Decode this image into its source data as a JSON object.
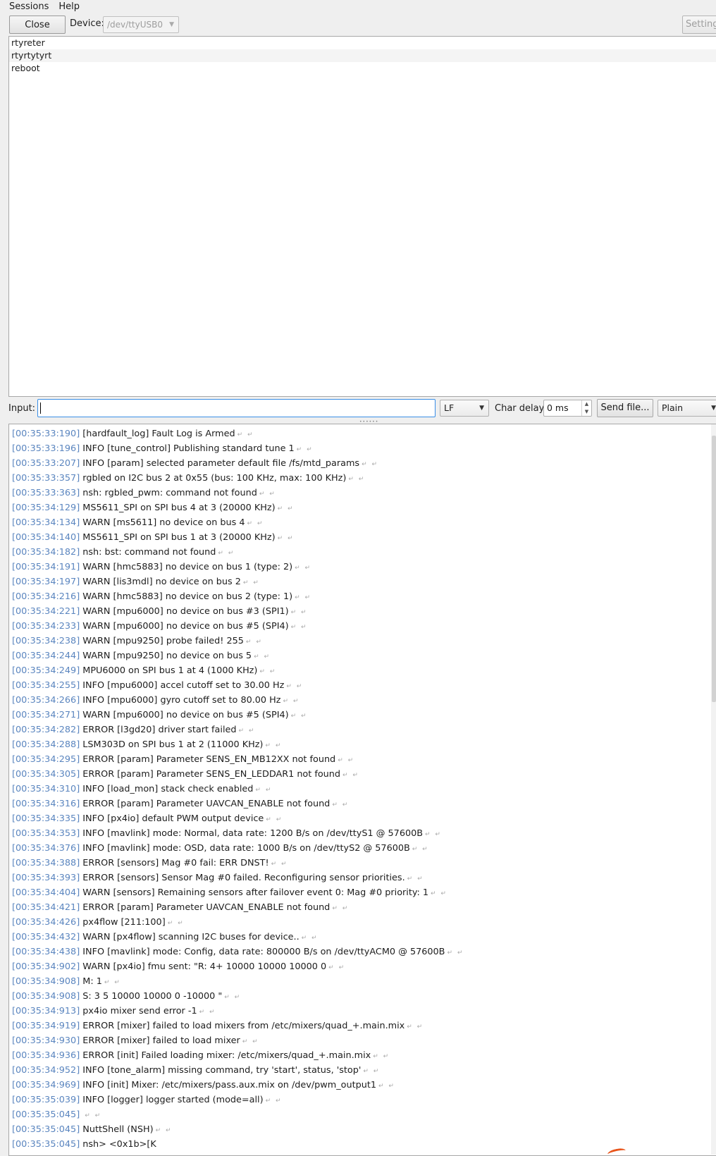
{
  "menubar": {
    "items": [
      {
        "label": "Sessions"
      },
      {
        "label": "Help"
      }
    ]
  },
  "toolbar": {
    "close_label": "Close",
    "device_label": "Device:",
    "device_value": "/dev/ttyUSB0",
    "settings_label": "Settings"
  },
  "history": {
    "items": [
      "rtyreter",
      "rtyrtytyrt",
      "reboot"
    ]
  },
  "input_row": {
    "input_label": "Input:",
    "input_value": "",
    "line_ending": "LF",
    "char_delay_label": "Char delay:",
    "char_delay_value": "0 ms",
    "send_file_label": "Send file...",
    "format": "Plain"
  },
  "log": {
    "lines": [
      {
        "ts": "[00:35:33:190]",
        "msg": "[hardfault_log] Fault Log is Armed"
      },
      {
        "ts": "[00:35:33:196]",
        "msg": "INFO  [tune_control] Publishing standard tune 1"
      },
      {
        "ts": "[00:35:33:207]",
        "msg": "INFO  [param] selected parameter default file /fs/mtd_params"
      },
      {
        "ts": "[00:35:33:357]",
        "msg": "rgbled on I2C bus 2 at 0x55 (bus: 100 KHz, max: 100 KHz)"
      },
      {
        "ts": "[00:35:33:363]",
        "msg": "nsh: rgbled_pwm: command not found"
      },
      {
        "ts": "[00:35:34:129]",
        "msg": "MS5611_SPI on SPI bus 4 at 3 (20000 KHz)"
      },
      {
        "ts": "[00:35:34:134]",
        "msg": "WARN  [ms5611] no device on bus 4"
      },
      {
        "ts": "[00:35:34:140]",
        "msg": "MS5611_SPI on SPI bus 1 at 3 (20000 KHz)"
      },
      {
        "ts": "[00:35:34:182]",
        "msg": "nsh: bst: command not found"
      },
      {
        "ts": "[00:35:34:191]",
        "msg": "WARN  [hmc5883] no device on bus 1 (type: 2)"
      },
      {
        "ts": "[00:35:34:197]",
        "msg": "WARN  [lis3mdl] no device on bus 2"
      },
      {
        "ts": "[00:35:34:216]",
        "msg": "WARN  [hmc5883] no device on bus 2 (type: 1)"
      },
      {
        "ts": "[00:35:34:221]",
        "msg": "WARN  [mpu6000] no device on bus #3 (SPI1)"
      },
      {
        "ts": "[00:35:34:233]",
        "msg": "WARN  [mpu6000] no device on bus #5 (SPI4)"
      },
      {
        "ts": "[00:35:34:238]",
        "msg": "WARN  [mpu9250] probe failed! 255"
      },
      {
        "ts": "[00:35:34:244]",
        "msg": "WARN  [mpu9250] no device on bus 5"
      },
      {
        "ts": "[00:35:34:249]",
        "msg": "MPU6000 on SPI bus 1 at 4 (1000 KHz)"
      },
      {
        "ts": "[00:35:34:255]",
        "msg": "INFO  [mpu6000] accel cutoff set to 30.00 Hz"
      },
      {
        "ts": "[00:35:34:266]",
        "msg": "INFO  [mpu6000] gyro cutoff set to 80.00 Hz"
      },
      {
        "ts": "[00:35:34:271]",
        "msg": "WARN  [mpu6000] no device on bus #5 (SPI4)"
      },
      {
        "ts": "[00:35:34:282]",
        "msg": "ERROR [l3gd20] driver start failed"
      },
      {
        "ts": "[00:35:34:288]",
        "msg": "LSM303D on SPI bus 1 at 2 (11000 KHz)"
      },
      {
        "ts": "[00:35:34:295]",
        "msg": "ERROR [param] Parameter SENS_EN_MB12XX not found"
      },
      {
        "ts": "[00:35:34:305]",
        "msg": "ERROR [param] Parameter SENS_EN_LEDDAR1 not found"
      },
      {
        "ts": "[00:35:34:310]",
        "msg": "INFO  [load_mon] stack check enabled"
      },
      {
        "ts": "[00:35:34:316]",
        "msg": "ERROR [param] Parameter UAVCAN_ENABLE not found"
      },
      {
        "ts": "[00:35:34:335]",
        "msg": "INFO  [px4io] default PWM output device"
      },
      {
        "ts": "[00:35:34:353]",
        "msg": "INFO  [mavlink] mode: Normal, data rate: 1200 B/s on /dev/ttyS1 @ 57600B"
      },
      {
        "ts": "[00:35:34:376]",
        "msg": "INFO  [mavlink] mode: OSD, data rate: 1000 B/s on /dev/ttyS2 @ 57600B"
      },
      {
        "ts": "[00:35:34:388]",
        "msg": "ERROR [sensors] Mag #0 fail:  ERR DNST!"
      },
      {
        "ts": "[00:35:34:393]",
        "msg": "ERROR [sensors] Sensor Mag #0 failed. Reconfiguring sensor priorities."
      },
      {
        "ts": "[00:35:34:404]",
        "msg": "WARN  [sensors] Remaining sensors after failover event 0: Mag #0 priority: 1"
      },
      {
        "ts": "[00:35:34:421]",
        "msg": "ERROR [param] Parameter UAVCAN_ENABLE not found"
      },
      {
        "ts": "[00:35:34:426]",
        "msg": "px4flow [211:100]"
      },
      {
        "ts": "[00:35:34:432]",
        "msg": "WARN  [px4flow] scanning I2C buses for device.."
      },
      {
        "ts": "[00:35:34:438]",
        "msg": "INFO  [mavlink] mode: Config, data rate: 800000 B/s on /dev/ttyACM0 @ 57600B"
      },
      {
        "ts": "[00:35:34:902]",
        "msg": "WARN  [px4io] fmu sent: \"R: 4+ 10000 10000 10000 0"
      },
      {
        "ts": "[00:35:34:908]",
        "msg": "M: 1"
      },
      {
        "ts": "[00:35:34:908]",
        "msg": "S: 3 5 10000 10000 0 -10000 \""
      },
      {
        "ts": "[00:35:34:913]",
        "msg": "px4io mixer send error -1"
      },
      {
        "ts": "[00:35:34:919]",
        "msg": "ERROR [mixer] failed to load mixers from /etc/mixers/quad_+.main.mix"
      },
      {
        "ts": "[00:35:34:930]",
        "msg": "ERROR [mixer] failed to load mixer"
      },
      {
        "ts": "[00:35:34:936]",
        "msg": "ERROR  [init] Failed loading mixer: /etc/mixers/quad_+.main.mix"
      },
      {
        "ts": "[00:35:34:952]",
        "msg": "INFO  [tone_alarm] missing command, try 'start', status, 'stop'"
      },
      {
        "ts": "[00:35:34:969]",
        "msg": "INFO  [init] Mixer: /etc/mixers/pass.aux.mix on /dev/pwm_output1"
      },
      {
        "ts": "[00:35:35:039]",
        "msg": "INFO  [logger] logger started (mode=all)"
      },
      {
        "ts": "[00:35:35:045]",
        "msg": ""
      },
      {
        "ts": "[00:35:35:045]",
        "msg": "NuttShell (NSH)"
      },
      {
        "ts": "[00:35:35:045]",
        "msg": "nsh> <0x1b>[K",
        "no_eol": true
      }
    ]
  }
}
